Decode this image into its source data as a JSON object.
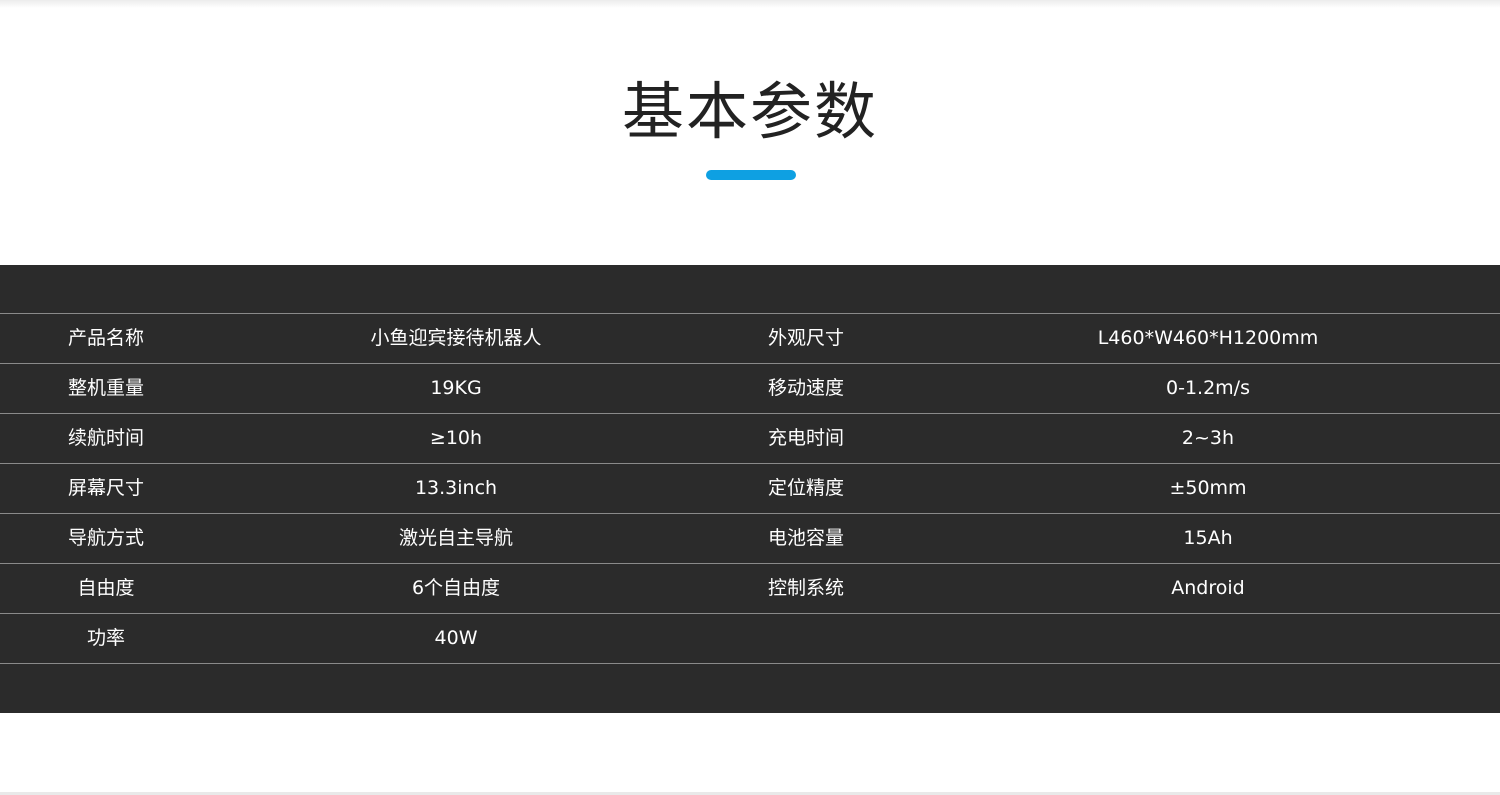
{
  "section": {
    "title": "基本参数",
    "accent_color": "#0ea0e2",
    "panel_color": "#2b2b2b"
  },
  "specs": [
    {
      "label1": "产品名称",
      "value1": "小鱼迎宾接待机器人",
      "label2": "外观尺寸",
      "value2": "L460*W460*H1200mm"
    },
    {
      "label1": "整机重量",
      "value1": "19KG",
      "label2": "移动速度",
      "value2": "0-1.2m/s"
    },
    {
      "label1": "续航时间",
      "value1": "≥10h",
      "label2": "充电时间",
      "value2": "2~3h"
    },
    {
      "label1": "屏幕尺寸",
      "value1": "13.3inch",
      "label2": "定位精度",
      "value2": "±50mm"
    },
    {
      "label1": "导航方式",
      "value1": "激光自主导航",
      "label2": "电池容量",
      "value2": "15Ah"
    },
    {
      "label1": "自由度",
      "value1": "6个自由度",
      "label2": "控制系统",
      "value2": "Android"
    },
    {
      "label1": "功率",
      "value1": "40W",
      "label2": "",
      "value2": ""
    }
  ]
}
